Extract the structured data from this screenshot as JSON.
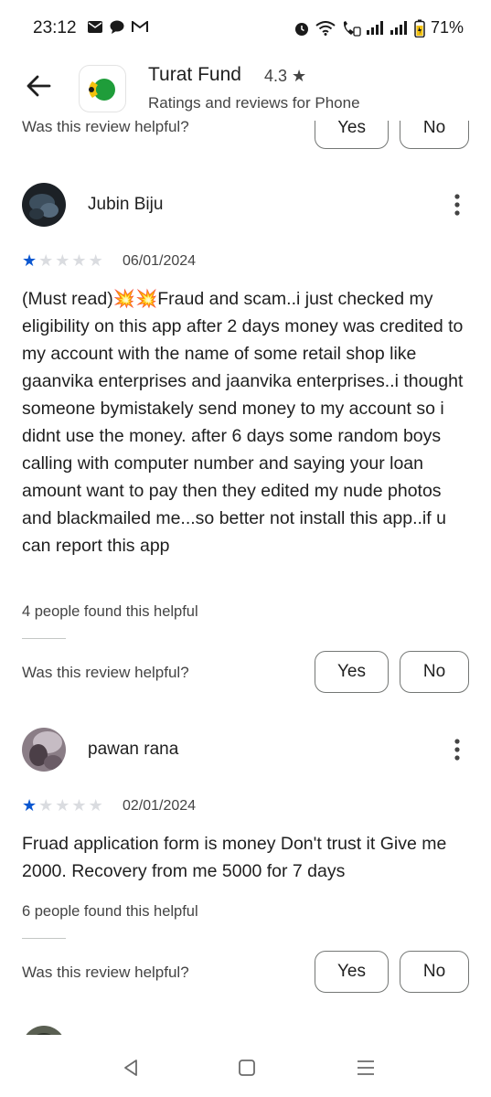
{
  "status": {
    "time": "23:12",
    "battery": "71%",
    "left_icons": [
      "mail-icon",
      "chat-icon",
      "gmail-icon"
    ],
    "right_icons": [
      "alarm-icon",
      "wifi-icon",
      "call-icon",
      "signal-icon",
      "signal-icon",
      "battery-icon"
    ]
  },
  "header": {
    "title": "Turat Fund",
    "rating": "4.3",
    "subtitle": "Ratings and reviews for Phone"
  },
  "prev_review": {
    "helpful_question": "Was this review helpful?",
    "yes": "Yes",
    "no": "No"
  },
  "reviews": [
    {
      "name": "Jubin Biju",
      "stars": 1,
      "date": "06/01/2024",
      "text": "(Must read)💥💥Fraud and scam..i just checked my eligibility on this app after 2 days money was credited to my account with the name of some retail shop like gaanvika enterprises and jaanvika enterprises..i thought someone bymistakely send money to my account so i didnt use the money. after 6 days some random boys calling with computer number and saying your loan amount want to pay then they edited my nude photos and blackmailed me...so better not install this app..if u can report this app",
      "found_helpful": "4 people found this helpful",
      "helpful_question": "Was this review helpful?",
      "yes": "Yes",
      "no": "No"
    },
    {
      "name": "pawan rana",
      "stars": 1,
      "date": "02/01/2024",
      "text": "Fruad application form is money Don't trust it Give me 2000. Recovery from me 5000 for 7 days",
      "found_helpful": "6 people found this helpful",
      "helpful_question": "Was this review helpful?",
      "yes": "Yes",
      "no": "No"
    }
  ],
  "colors": {
    "star_on": "#0b57d0",
    "star_off": "#dadce0",
    "app_icon_green": "#1f9d3a",
    "app_icon_yellow": "#f4c20d"
  }
}
